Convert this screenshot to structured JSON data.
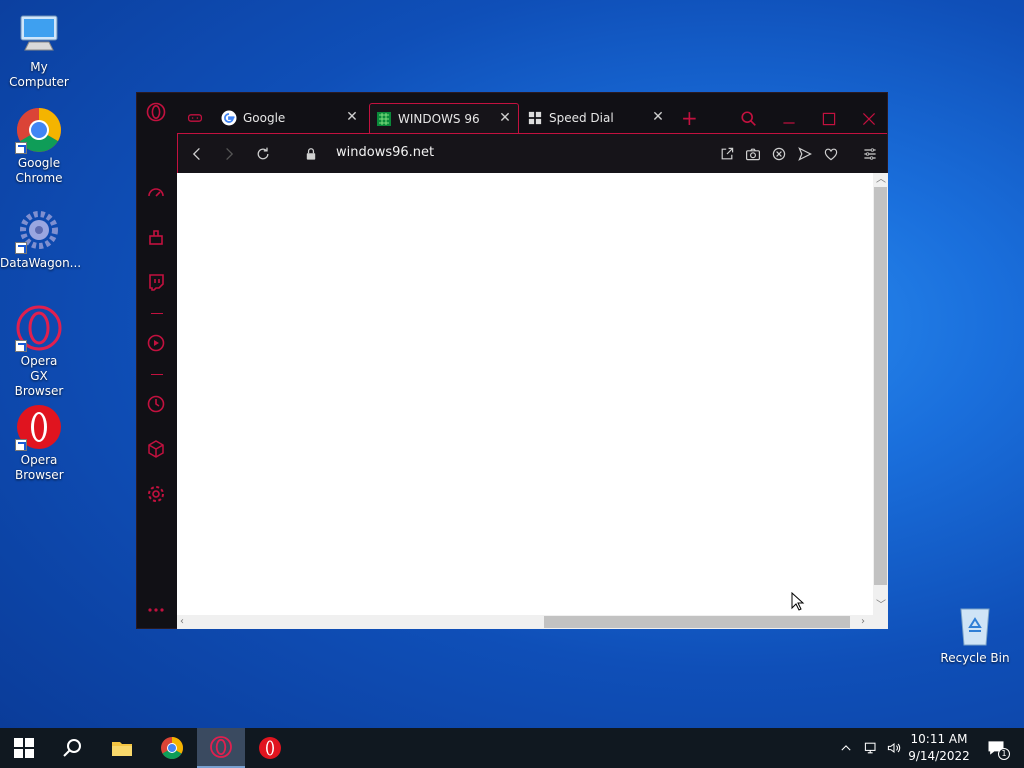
{
  "desktop": {
    "icons": [
      {
        "label": "My Computer"
      },
      {
        "label": "Google Chrome"
      },
      {
        "label": "DataWagon..."
      },
      {
        "label": "Opera GX Browser"
      },
      {
        "label": "Opera Browser"
      },
      {
        "label": "Recycle Bin"
      }
    ]
  },
  "browser": {
    "tabs": [
      {
        "label": "Google"
      },
      {
        "label": "WINDOWS 96"
      },
      {
        "label": "Speed Dial"
      }
    ],
    "url": "windows96.net",
    "accent_color": "#c3113f"
  },
  "taskbar": {
    "time": "10:11 AM",
    "date": "9/14/2022",
    "notification_count": "1"
  }
}
